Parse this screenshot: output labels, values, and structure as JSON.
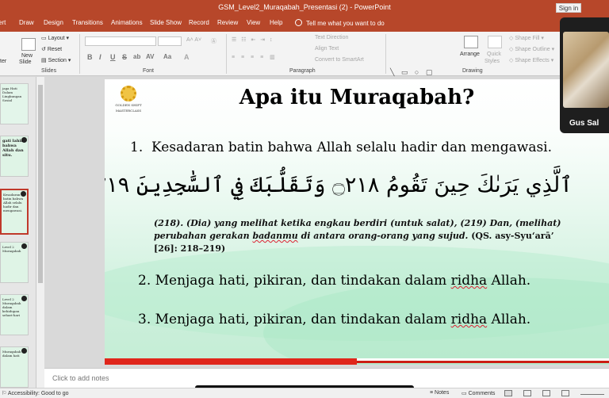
{
  "window": {
    "title": "GSM_Level2_Muraqabah_Presentasi (2)  -  PowerPoint",
    "sign_in": "Sign in"
  },
  "ribbon_tabs": [
    "ert",
    "Draw",
    "Design",
    "Transitions",
    "Animations",
    "Slide Show",
    "Record",
    "Review",
    "View",
    "Help"
  ],
  "tell_me": "Tell me what you want to do",
  "ribbon": {
    "slides_group": {
      "label": "Slides",
      "new_slide": "New",
      "new_slide_2": "Slide",
      "layout": "Layout",
      "reset": "Reset",
      "section": "Section",
      "left_cut": "ter"
    },
    "font_group": {
      "label": "Font",
      "bold": "B",
      "italic": "I",
      "underline": "U",
      "strike": "S",
      "shadow": "ab",
      "spacing": "AV",
      "case": "Aa"
    },
    "paragraph_group": {
      "label": "Paragraph",
      "text_direction": "Text Direction",
      "align_text": "Align Text",
      "convert_smartart": "Convert to SmartArt"
    },
    "drawing_group": {
      "label": "Drawing",
      "arrange": "Arrange",
      "quick_styles": "Quick",
      "quick_styles_2": "Styles",
      "shape_fill": "Shape Fill",
      "shape_outline": "Shape Outline",
      "shape_effects": "Shape Effects"
    }
  },
  "thumbnails": [
    {
      "text": "jaga Hati Dalam Lingkungan Sosial",
      "selected": false
    },
    {
      "text": "gati lahir bahwa Allah dan situ.",
      "selected": false
    },
    {
      "text": "Kesadaran batin bahwa Allah selalu hadir dan mengawasi.",
      "selected": true
    },
    {
      "text": "Level 2 Muraqabah",
      "selected": false
    },
    {
      "text": "Level 2 Muraqabah dalam kehidupan sehari-hari",
      "selected": false
    },
    {
      "text": "Muraqabah dalam hati",
      "selected": false
    }
  ],
  "slide": {
    "logo_text_1": "GOLDEN SHIFT",
    "logo_text_2": "MASTERCLASS",
    "title": "Apa itu Muraqabah?",
    "point1_number": "1.",
    "point1_text": "Kesadaran batin bahwa Allah selalu hadir dan mengawasi.",
    "arabic_verse": "ٱلَّذِي يَرَىٰكَ حِينَ تَقُومُ ۝٢١٨ وَتَقَلُّبَكَ فِي ٱلسَّٰجِدِينَ ۝٢١٩",
    "translation_part1": "(218). (Dia) yang melihat ketika engkau berdiri (untuk salat), (219) Dan, (melihat) perubahan gerakan ",
    "translation_ul": "badanmu",
    "translation_part2": " di antara orang-orang yang sujud.",
    "translation_ref": " (QS. asy-Syu‘arā’ [26]: 218–219)",
    "point2_pre": "2. Menjaga hati, pikiran, dan tindakan dalam ",
    "point2_ul": "ridha",
    "point2_post": " Allah.",
    "point3_pre": "3. Menjaga hati, pikiran, dan tindakan dalam ",
    "point3_ul": "ridha",
    "point3_post": " Allah."
  },
  "notes_placeholder": "Click to add notes",
  "status": {
    "accessibility": "Accessibility: Good to go",
    "notes": "Notes",
    "comments": "Comments"
  },
  "video": {
    "participant": "Gus Sal"
  },
  "colors": {
    "accent": "#b7472a",
    "slide_bar": "#e0261b"
  }
}
